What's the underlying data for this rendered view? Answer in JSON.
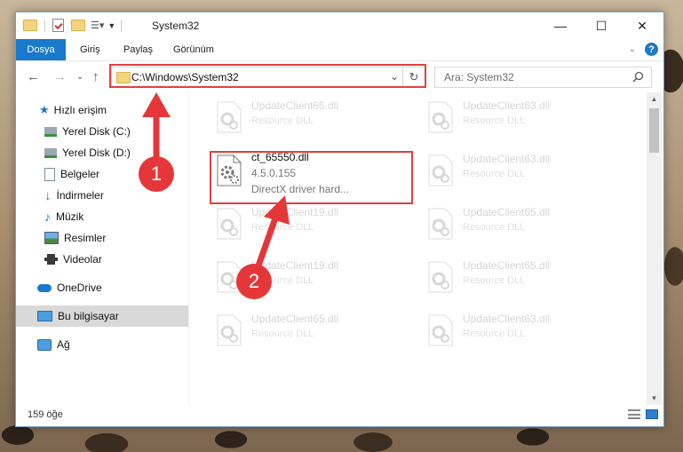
{
  "window": {
    "title": "System32",
    "controls": {
      "minimize": "—",
      "maximize": "☐",
      "close": "✕"
    }
  },
  "ribbon": {
    "tabs": [
      "Dosya",
      "Giriş",
      "Paylaş",
      "Görünüm"
    ]
  },
  "navigation": {
    "address": "C:\\Windows\\System32",
    "search_placeholder": "Ara: System32"
  },
  "sidebar": {
    "items": [
      {
        "label": "Hızlı erişim",
        "icon": "star-icon"
      },
      {
        "label": "Yerel Disk (C:)",
        "icon": "drive-icon",
        "pinned": true
      },
      {
        "label": "Yerel Disk (D:)",
        "icon": "drive-icon",
        "pinned": true
      },
      {
        "label": "Belgeler",
        "icon": "documents-icon",
        "pinned": true
      },
      {
        "label": "İndirmeler",
        "icon": "downloads-icon",
        "pinned": true
      },
      {
        "label": "Müzik",
        "icon": "music-icon",
        "pinned": true
      },
      {
        "label": "Resimler",
        "icon": "pictures-icon",
        "pinned": true
      },
      {
        "label": "Videolar",
        "icon": "videos-icon",
        "pinned": true
      },
      {
        "label": "OneDrive",
        "icon": "cloud-icon"
      },
      {
        "label": "Bu bilgisayar",
        "icon": "computer-icon",
        "selected": true
      },
      {
        "label": "Ağ",
        "icon": "network-icon"
      }
    ]
  },
  "files": {
    "active": {
      "name": "ct_65550.dll",
      "version": "4.5.0.155",
      "description": "DirectX driver hard..."
    },
    "background": [
      {
        "name": "UpdateClient65.dll",
        "type": "Resource DLL"
      },
      {
        "name": "UpdateClient63.dll",
        "type": "Resource DLL"
      },
      {
        "name": "UpdateClient63.dll",
        "type": "Resource DLL"
      },
      {
        "name": "UpdateClient19.dll",
        "type": "Resource DLL"
      },
      {
        "name": "UpdateClient65.dll",
        "type": "Resource DLL"
      },
      {
        "name": "UpdateClient19.dll",
        "type": "Resource DLL"
      },
      {
        "name": "UpdateClient65.dll",
        "type": "Resource DLL"
      },
      {
        "name": "UpdateClient65.dll",
        "type": "Resource DLL"
      },
      {
        "name": "UpdateClient63.dll",
        "type": "Resource DLL"
      }
    ]
  },
  "status": {
    "item_count": "159 öğe"
  },
  "annotations": {
    "step1": "1",
    "step2": "2"
  },
  "colors": {
    "accent": "#1979ca",
    "highlight": "#e04040",
    "badge": "#e5373a"
  }
}
